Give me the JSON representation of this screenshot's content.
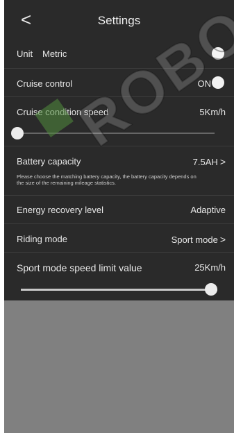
{
  "header": {
    "title": "Settings",
    "back_icon": "chevron-left-icon",
    "back_glyph": "<"
  },
  "rows": {
    "unit": {
      "label": "Unit",
      "value": "Metric"
    },
    "cruise_control": {
      "label": "Cruise control",
      "value": "ON"
    },
    "cruise_speed": {
      "label": "Cruise condition speed",
      "value": "5Km/h",
      "slider_fraction": 0.0
    },
    "battery": {
      "label": "Battery capacity",
      "value": "7.5AH",
      "chevron": ">",
      "note": "Please choose the matching battery capacity, the battery capacity depends on the size of the remaining mileage statistics."
    },
    "energy_recovery": {
      "label": "Energy recovery level",
      "value": "Adaptive"
    },
    "riding_mode": {
      "label": "Riding mode",
      "value": "Sport mode",
      "chevron": ">"
    },
    "sport_limit": {
      "label": "Sport mode speed limit value",
      "value": "25Km/h",
      "slider_fraction": 1.0
    }
  },
  "watermark": {
    "text": "ROBO"
  },
  "colors": {
    "panel": "#2a2a2a",
    "lower_area": "#808080",
    "text": "#e8e8e8"
  }
}
